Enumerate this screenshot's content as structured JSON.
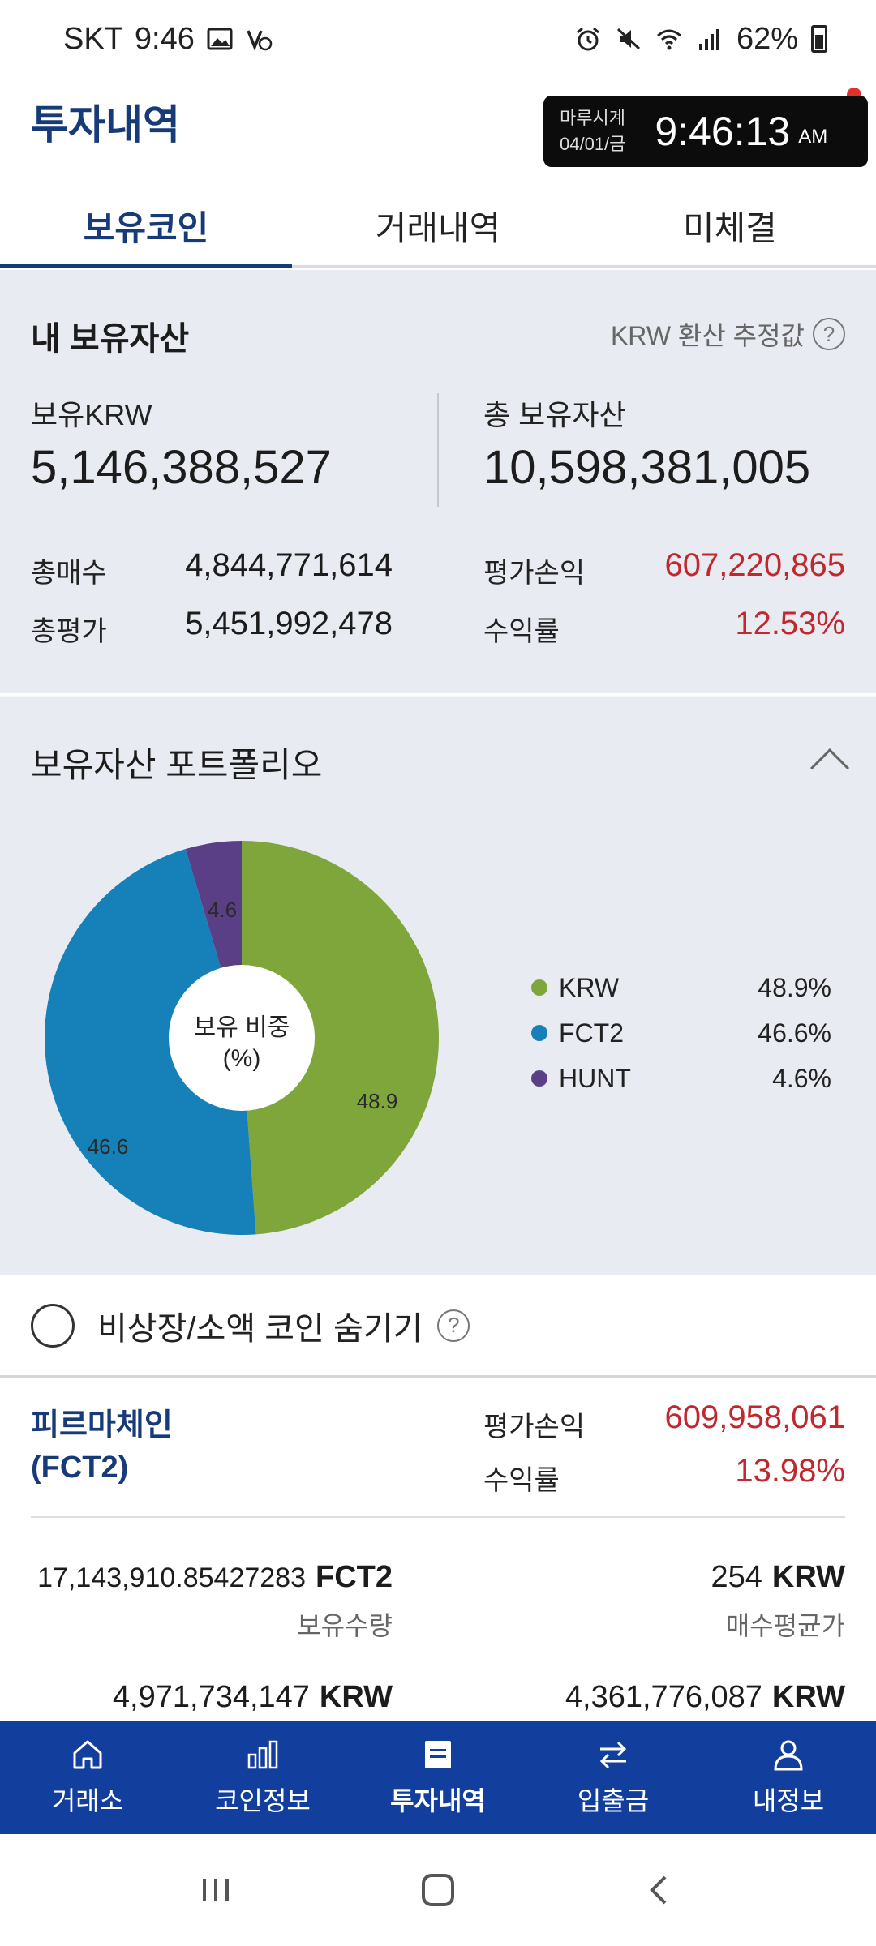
{
  "status_bar": {
    "carrier": "SKT",
    "time": "9:46",
    "battery": "62%"
  },
  "header": {
    "title": "투자내역"
  },
  "clock_overlay": {
    "app_name": "마루시계",
    "date": "04/01/금",
    "time": "9:46:13",
    "ampm": "AM"
  },
  "tabs": [
    {
      "label": "보유코인",
      "active": true
    },
    {
      "label": "거래내역",
      "active": false
    },
    {
      "label": "미체결",
      "active": false
    }
  ],
  "assets": {
    "title": "내 보유자산",
    "note": "KRW 환산 추정값",
    "krw_label": "보유KRW",
    "krw_value": "5,146,388,527",
    "total_label": "총 보유자산",
    "total_value": "10,598,381,005",
    "buy_label": "총매수",
    "buy_value": "4,844,771,614",
    "eval_label": "총평가",
    "eval_value": "5,451,992,478",
    "pnl_label": "평가손익",
    "pnl_value": "607,220,865",
    "rate_label": "수익률",
    "rate_value": "12.53%"
  },
  "portfolio": {
    "title": "보유자산 포트폴리오",
    "center_line1": "보유 비중",
    "center_line2": "(%)",
    "slice_labels": [
      "48.9",
      "46.6",
      "4.6"
    ],
    "legend": [
      {
        "name": "KRW",
        "value": "48.9%",
        "color": "#7ea63a"
      },
      {
        "name": "FCT2",
        "value": "46.6%",
        "color": "#1680b8"
      },
      {
        "name": "HUNT",
        "value": "4.6%",
        "color": "#5a3f87"
      }
    ]
  },
  "chart_data": {
    "type": "pie",
    "categories": [
      "KRW",
      "FCT2",
      "HUNT"
    ],
    "values": [
      48.9,
      46.6,
      4.6
    ]
  },
  "hide_row": {
    "label": "비상장/소액 코인 숨기기"
  },
  "coin": {
    "name_line1": "피르마체인",
    "name_line2": "(FCT2)",
    "pnl_label": "평가손익",
    "pnl_value": "609,958,061",
    "rate_label": "수익률",
    "rate_value": "13.98%",
    "qty_value": "17,143,910.85427283",
    "qty_unit": "FCT2",
    "qty_label": "보유수량",
    "avg_value": "254",
    "avg_unit": "KRW",
    "avg_label": "매수평균가",
    "eval_value": "4,971,734,147",
    "eval_unit": "KRW",
    "buy_value": "4,361,776,087",
    "buy_unit": "KRW"
  },
  "bottom_nav": [
    {
      "label": "거래소",
      "icon": "home-icon",
      "active": false
    },
    {
      "label": "코인정보",
      "icon": "bar-chart-icon",
      "active": false
    },
    {
      "label": "투자내역",
      "icon": "document-icon",
      "active": true
    },
    {
      "label": "입출금",
      "icon": "transfer-icon",
      "active": false
    },
    {
      "label": "내정보",
      "icon": "person-icon",
      "active": false
    }
  ]
}
